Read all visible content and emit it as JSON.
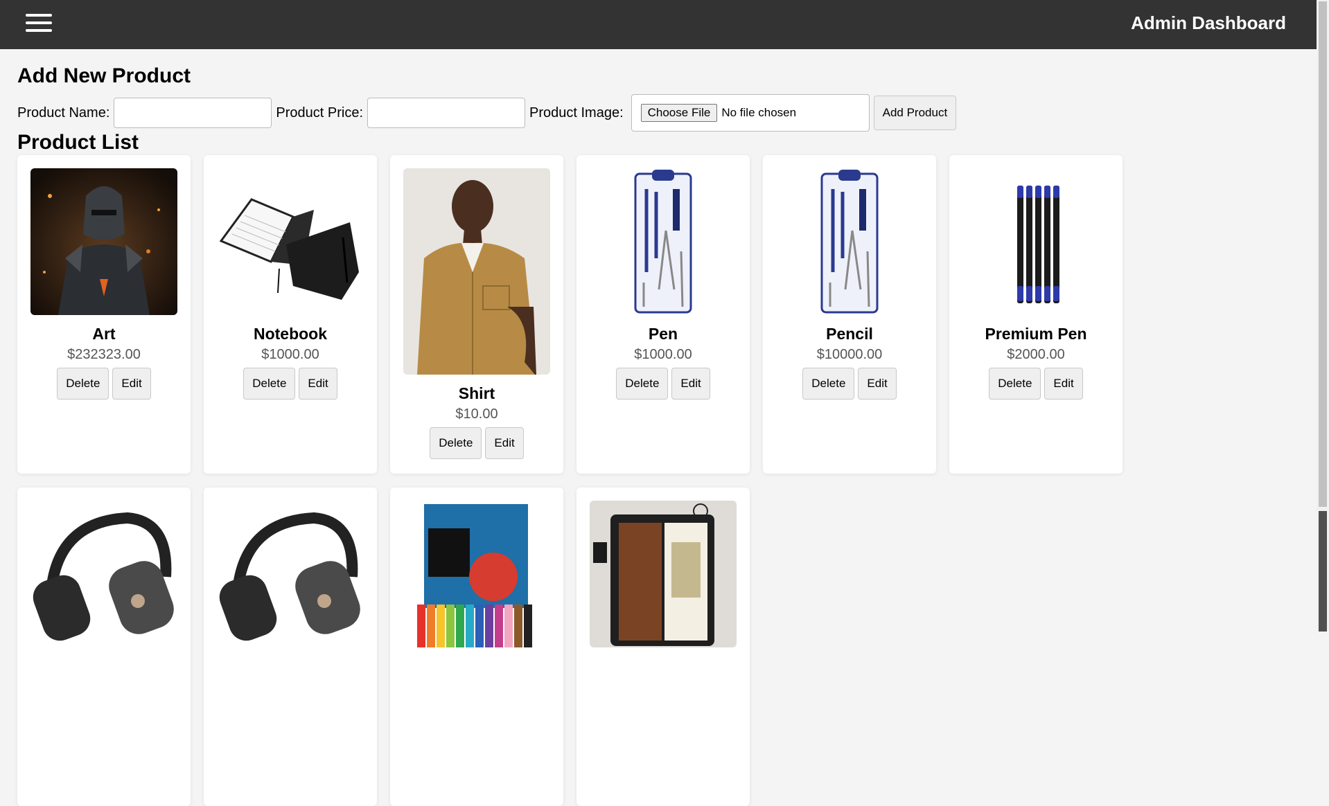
{
  "header": {
    "title": "Admin Dashboard"
  },
  "add_form": {
    "title": "Add New Product",
    "name_label": "Product Name:",
    "price_label": "Product Price:",
    "image_label": "Product Image:",
    "choose_file": "Choose File",
    "no_file": "No file chosen",
    "submit": "Add Product"
  },
  "list": {
    "title": "Product List",
    "delete_label": "Delete",
    "edit_label": "Edit",
    "products": [
      {
        "name": "Art",
        "price": "$232323.00"
      },
      {
        "name": "Notebook",
        "price": "$1000.00"
      },
      {
        "name": "Shirt",
        "price": "$10.00"
      },
      {
        "name": "Pen",
        "price": "$1000.00"
      },
      {
        "name": "Pencil",
        "price": "$10000.00"
      },
      {
        "name": "Premium Pen",
        "price": "$2000.00"
      }
    ]
  },
  "colors": {
    "topbar": "#333333",
    "page_bg": "#f4f4f4"
  }
}
